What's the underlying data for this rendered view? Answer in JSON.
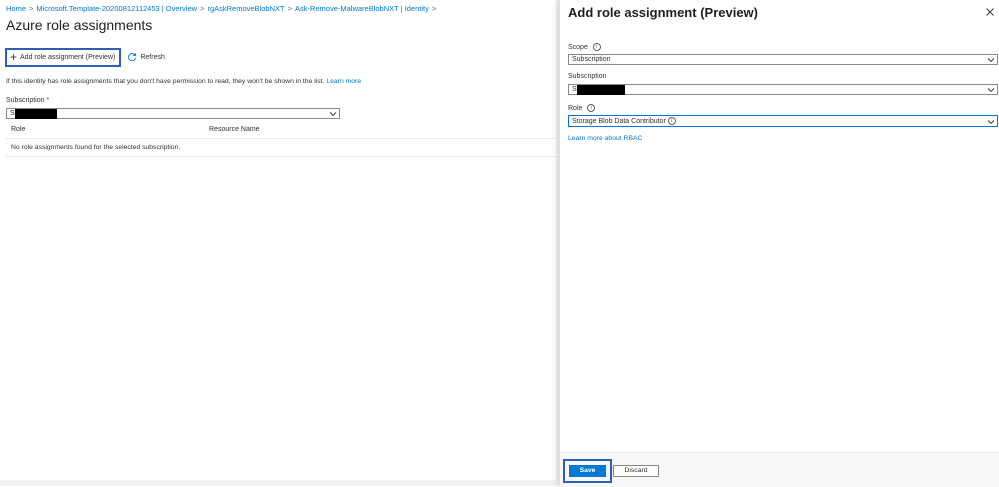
{
  "breadcrumb": [
    {
      "label": "Home"
    },
    {
      "label": "Microsoft.Template-20200812112453 | Overview"
    },
    {
      "label": "rgAskRemoveBlobNXT"
    },
    {
      "label": "Ask-Remove-MalwareBlobNXT | Identity"
    }
  ],
  "page": {
    "title": "Azure role assignments"
  },
  "toolbar": {
    "add_label": "Add role assignment (Preview)",
    "refresh_label": "Refresh"
  },
  "info": {
    "text": "If this identity has role assignments that you don't have permission to read, they won't be shown in the list.",
    "link": "Learn more"
  },
  "subscription_filter": {
    "label": "Subscription",
    "required_mark": "*",
    "value": "S"
  },
  "table": {
    "columns": [
      "Role",
      "Resource Name"
    ],
    "empty_message": "No role assignments found for the selected subscription."
  },
  "panel": {
    "title": "Add role assignment (Preview)",
    "scope": {
      "label": "Scope",
      "value": "Subscription"
    },
    "subscription": {
      "label": "Subscription",
      "value": "S"
    },
    "role": {
      "label": "Role",
      "value": "Storage Blob Data Contributor"
    },
    "rbac_link": "Learn more about RBAC",
    "save_label": "Save",
    "discard_label": "Discard"
  },
  "icons": {
    "add": "plus-icon",
    "refresh": "refresh-icon",
    "close": "close-icon",
    "info": "info-icon",
    "dropdown": "chevron-down-icon"
  },
  "colors": {
    "accent": "#0078d4",
    "highlight_border": "#2f5fb5",
    "required": "#a4262c"
  }
}
